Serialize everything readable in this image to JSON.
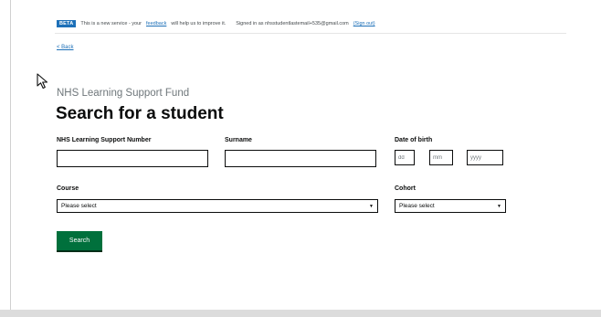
{
  "phase_banner": {
    "tag": "BETA",
    "text_before_link": "This is a new service - your",
    "feedback_link": "feedback",
    "text_after_link": "will help us to improve it.",
    "signed_in_text": "Signed in as nhsstudentlastemail+535@gmail.com",
    "sign_out_link": "(Sign out)"
  },
  "back_link": "< Back",
  "service_name": "NHS Learning Support Fund",
  "page_title": "Search for a student",
  "form": {
    "lsf_number_label": "NHS Learning Support Number",
    "lsf_number_value": "",
    "surname_label": "Surname",
    "surname_value": "",
    "dob_label": "Date of birth",
    "dob_day_placeholder": "dd",
    "dob_month_placeholder": "mm",
    "dob_year_placeholder": "yyyy",
    "course_label": "Course",
    "course_value": "Please select",
    "cohort_label": "Cohort",
    "cohort_value": "Please select",
    "search_button": "Search"
  },
  "colors": {
    "link": "#1d70b8",
    "beta_tag": "#1d70b8",
    "button": "#00703c",
    "service_name": "#6f777b"
  },
  "icons": {
    "cursor": "mouse-pointer-icon",
    "dropdown": "chevron-down-icon"
  }
}
